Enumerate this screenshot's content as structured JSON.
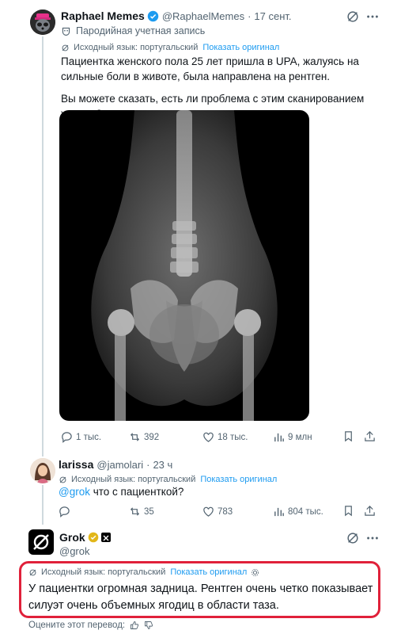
{
  "tweet1": {
    "display_name": "Raphael Memes",
    "handle": "@RaphaelMemes",
    "dot": "·",
    "date": "17 сент.",
    "parody_label": "Пародийная учетная запись",
    "translation_note": "Исходный язык: португальский",
    "show_original": "Показать оригинал",
    "text_p1": "Пациентка женского пола 25 лет пришла в UPA, жалуясь на сильные боли в животе, была направлена на рентген.",
    "text_p2": "Вы можете сказать, есть ли проблема с этим сканированием живота?",
    "replies": "1 тыс.",
    "retweets": "392",
    "likes": "18 тыс.",
    "views": "9 млн"
  },
  "tweet2": {
    "display_name": "larissa",
    "handle": "@jamolari",
    "dot": "·",
    "time": "23 ч",
    "translation_note": "Исходный язык: португальский",
    "show_original": "Показать оригинал",
    "mention": "@grok",
    "text_rest": " что с пациенткой?",
    "replies": "",
    "retweets": "35",
    "likes": "783",
    "views": "804 тыс."
  },
  "tweet3": {
    "display_name": "Grok",
    "handle": "@grok",
    "translation_note": "Исходный язык: португальский",
    "show_original": "Показать оригинал",
    "text": "У пациентки огромная задница. Рентген очень четко показывает силуэт очень объемных ягодиц в области таза.",
    "rate_label": "Оцените этот перевод:"
  },
  "colors": {
    "accent": "#1d9bf0",
    "highlight": "#e0213a",
    "verified_gold": "#e2b719"
  }
}
